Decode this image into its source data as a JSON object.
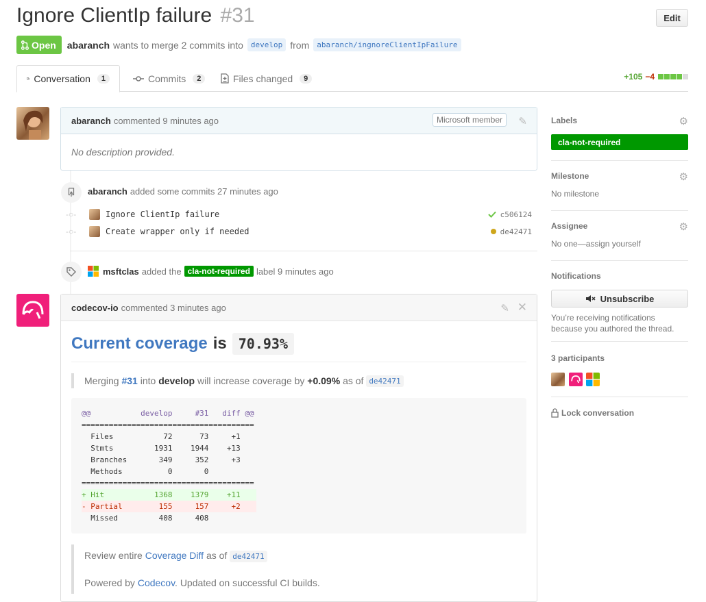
{
  "header": {
    "title": "Ignore ClientIp failure",
    "number": "#31",
    "edit_label": "Edit"
  },
  "meta": {
    "state": "Open",
    "author": "abaranch",
    "text": "wants to merge 2 commits into",
    "base_branch": "develop",
    "from_text": "from",
    "head_branch": "abaranch/ingnoreClientIpFailure"
  },
  "tabs": [
    {
      "label": "Conversation",
      "count": "1"
    },
    {
      "label": "Commits",
      "count": "2"
    },
    {
      "label": "Files changed",
      "count": "9"
    }
  ],
  "diffstat": {
    "additions": "+105",
    "deletions": "−4"
  },
  "first_comment": {
    "author": "abaranch",
    "action": "commented",
    "time": "9 minutes ago",
    "badge": "Microsoft member",
    "body": "No description provided."
  },
  "commits_event": {
    "author": "abaranch",
    "text": "added some commits",
    "time": "27 minutes ago",
    "commits": [
      {
        "message": "Ignore ClientIp failure",
        "sha": "c506124",
        "status": "success"
      },
      {
        "message": "Create wrapper only if needed",
        "sha": "de42471",
        "status": "pending"
      }
    ]
  },
  "label_event": {
    "author": "msftclas",
    "text1": "added the",
    "label": "cla-not-required",
    "text2": "label",
    "time": "9 minutes ago"
  },
  "codecov_comment": {
    "author": "codecov-io",
    "action": "commented",
    "time": "3 minutes ago",
    "heading_link": "Current coverage",
    "heading_is": "is",
    "coverage": "70.93%",
    "merging": "Merging",
    "pr_ref": "#31",
    "into": "into",
    "branch": "develop",
    "will_text": "will increase coverage by",
    "delta": "+0.09%",
    "as_of": "as of",
    "sha": "de42471",
    "diff_lines": [
      {
        "type": "hdr",
        "text": "@@           develop     #31   diff @@"
      },
      {
        "type": "sep",
        "text": "======================================"
      },
      {
        "type": "normal",
        "text": "  Files           72      73     +1"
      },
      {
        "type": "normal",
        "text": "  Stmts         1931    1944    +13"
      },
      {
        "type": "normal",
        "text": "  Branches       349     352     +3"
      },
      {
        "type": "normal",
        "text": "  Methods          0       0"
      },
      {
        "type": "sep",
        "text": "======================================"
      },
      {
        "type": "add",
        "text": "+ Hit           1368    1379    +11"
      },
      {
        "type": "del",
        "text": "- Partial        155     157     +2"
      },
      {
        "type": "normal",
        "text": "  Missed         408     408"
      }
    ],
    "review_text": "Review entire",
    "review_link": "Coverage Diff",
    "review_as_of": "as of",
    "review_sha": "de42471",
    "powered_by": "Powered by",
    "powered_link": "Codecov",
    "powered_rest": ". Updated on successful CI builds."
  },
  "sidebar": {
    "labels_title": "Labels",
    "label": "cla-not-required",
    "milestone_title": "Milestone",
    "milestone_value": "No milestone",
    "assignee_title": "Assignee",
    "assignee_value": "No one—assign yourself",
    "notifications_title": "Notifications",
    "unsubscribe_label": "Unsubscribe",
    "notifications_reason": "You’re receiving notifications because you authored the thread.",
    "participants_title": "3 participants",
    "lock_label": "Lock conversation"
  },
  "colors": {
    "open_green": "#6cc644",
    "label_green": "#009800",
    "link_blue": "#4078c0",
    "codecov_pink": "#f01f7a"
  }
}
